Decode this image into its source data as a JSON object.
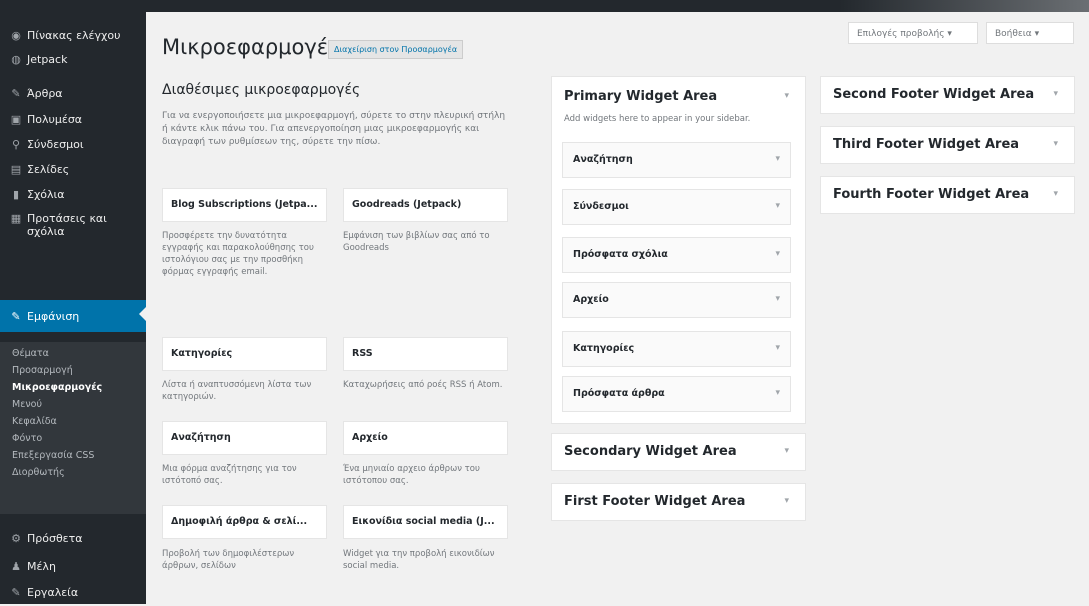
{
  "sidebar": {
    "items": [
      {
        "icon": "dashboard-icon",
        "glyph": "◉",
        "label": "Πίνακας ελέγχου"
      },
      {
        "icon": "jetpack-icon",
        "glyph": "◍",
        "label": "Jetpack"
      },
      {
        "icon": "pin-icon",
        "glyph": "✎",
        "label": "Άρθρα"
      },
      {
        "icon": "media-icon",
        "glyph": "▣",
        "label": "Πολυμέσα"
      },
      {
        "icon": "links-icon",
        "glyph": "⚲",
        "label": "Σύνδεσμοι"
      },
      {
        "icon": "pages-icon",
        "glyph": "▤",
        "label": "Σελίδες"
      },
      {
        "icon": "comments-icon",
        "glyph": "▮",
        "label": "Σχόλια"
      },
      {
        "icon": "feedback-icon",
        "glyph": "▦",
        "label": "Προτάσεις και σχόλια"
      },
      {
        "icon": "appearance-icon",
        "glyph": "✎",
        "label": "Εμφάνιση"
      },
      {
        "icon": "plugins-icon",
        "glyph": "⚙",
        "label": "Πρόσθετα"
      },
      {
        "icon": "users-icon",
        "glyph": "♟",
        "label": "Μέλη"
      },
      {
        "icon": "tools-icon",
        "glyph": "✎",
        "label": "Εργαλεία"
      }
    ],
    "submenu": [
      "Θέματα",
      "Προσαρμογή",
      "Μικροεφαρμογές",
      "Μενού",
      "Κεφαλίδα",
      "Φόντο",
      "Επεξεργασία CSS",
      "Διορθωτής"
    ]
  },
  "header": {
    "title": "Μικροεφαρμογές",
    "manage_label": "Διαχείριση στον Προσαρμογέα",
    "screen_options": "Επιλογές προβολής ▾",
    "help": "Βοήθεια ▾"
  },
  "available": {
    "title": "Διαθέσιμες μικροεφαρμογές",
    "description": "Για να ενεργοποιήσετε μια μικροεφαρμογή, σύρετε το στην πλευρική στήλη ή κάντε κλικ πάνω του. Για απενεργοποίηση μιας μικροεφαρμογής και διαγραφή των ρυθμίσεων της, σύρετε την πίσω.",
    "widgets": [
      {
        "name": "Blog Subscriptions (Jetpa...",
        "desc": "Προσφέρετε την δυνατότητα εγγραφής και παρακολούθησης του ιστολόγιου σας με την προσθήκη φόρμας εγγραφής email."
      },
      {
        "name": "Goodreads (Jetpack)",
        "desc": "Εμφάνιση των βιβλίων σας από το Goodreads"
      },
      {
        "name": "Κατηγορίες",
        "desc": "Λίστα ή αναπτυσσόμενη λίστα των κατηγοριών."
      },
      {
        "name": "RSS",
        "desc": "Καταχωρήσεις από ροές RSS ή Atom."
      },
      {
        "name": "Αναζήτηση",
        "desc": "Μια φόρμα αναζήτησης για τον ιστότοπό σας."
      },
      {
        "name": "Αρχείο",
        "desc": "Ένα μηνιαίο αρχειο άρθρων του ιστότοπου σας."
      },
      {
        "name": "Δημοφιλή άρθρα & σελί...",
        "desc": "Προβολή των δημοφιλέστερων άρθρων, σελίδων"
      },
      {
        "name": "Εικονίδια social media (J...",
        "desc": "Widget για την προβολή εικονιδίων social media."
      }
    ]
  },
  "primary": {
    "title": "Primary Widget Area",
    "description": "Add widgets here to appear in your sidebar.",
    "widgets": [
      "Αναζήτηση",
      "Σύνδεσμοι",
      "Πρόσφατα σχόλια",
      "Αρχείο",
      "Κατηγορίες",
      "Πρόσφατα άρθρα"
    ]
  },
  "areas_col2": [
    "Secondary Widget Area",
    "First Footer Widget Area"
  ],
  "areas_col3": [
    "Second Footer Widget Area",
    "Third Footer Widget Area",
    "Fourth Footer Widget Area"
  ],
  "arrow_glyph": "▾"
}
